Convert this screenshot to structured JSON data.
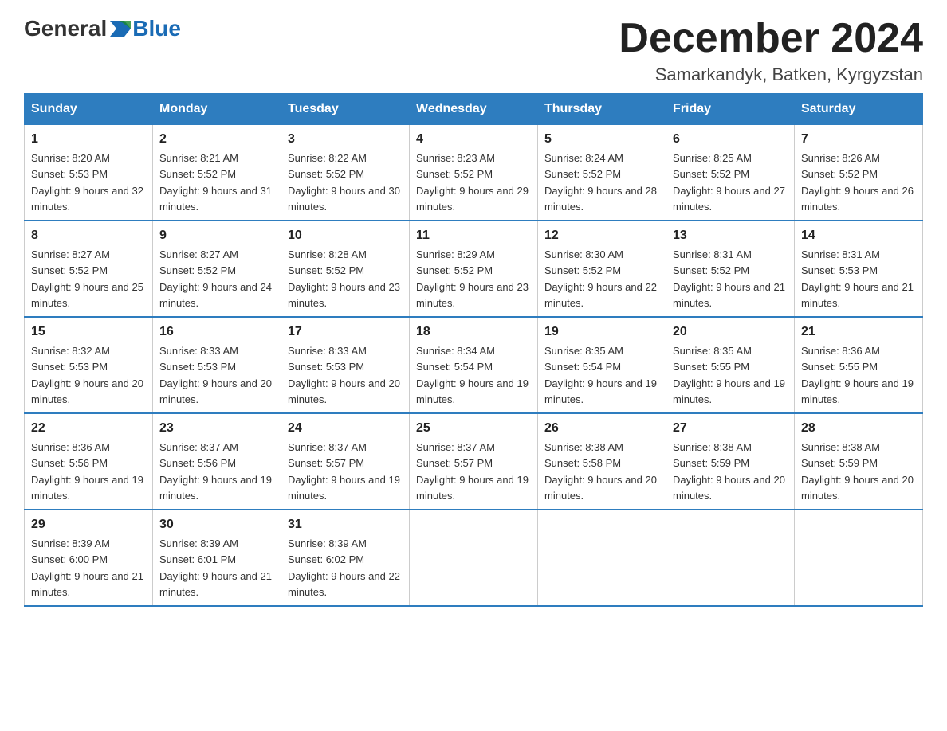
{
  "header": {
    "logo_general": "General",
    "logo_blue": "Blue",
    "month_title": "December 2024",
    "location": "Samarkandyk, Batken, Kyrgyzstan"
  },
  "weekdays": [
    "Sunday",
    "Monday",
    "Tuesday",
    "Wednesday",
    "Thursday",
    "Friday",
    "Saturday"
  ],
  "weeks": [
    [
      {
        "day": "1",
        "sunrise": "8:20 AM",
        "sunset": "5:53 PM",
        "daylight": "9 hours and 32 minutes."
      },
      {
        "day": "2",
        "sunrise": "8:21 AM",
        "sunset": "5:52 PM",
        "daylight": "9 hours and 31 minutes."
      },
      {
        "day": "3",
        "sunrise": "8:22 AM",
        "sunset": "5:52 PM",
        "daylight": "9 hours and 30 minutes."
      },
      {
        "day": "4",
        "sunrise": "8:23 AM",
        "sunset": "5:52 PM",
        "daylight": "9 hours and 29 minutes."
      },
      {
        "day": "5",
        "sunrise": "8:24 AM",
        "sunset": "5:52 PM",
        "daylight": "9 hours and 28 minutes."
      },
      {
        "day": "6",
        "sunrise": "8:25 AM",
        "sunset": "5:52 PM",
        "daylight": "9 hours and 27 minutes."
      },
      {
        "day": "7",
        "sunrise": "8:26 AM",
        "sunset": "5:52 PM",
        "daylight": "9 hours and 26 minutes."
      }
    ],
    [
      {
        "day": "8",
        "sunrise": "8:27 AM",
        "sunset": "5:52 PM",
        "daylight": "9 hours and 25 minutes."
      },
      {
        "day": "9",
        "sunrise": "8:27 AM",
        "sunset": "5:52 PM",
        "daylight": "9 hours and 24 minutes."
      },
      {
        "day": "10",
        "sunrise": "8:28 AM",
        "sunset": "5:52 PM",
        "daylight": "9 hours and 23 minutes."
      },
      {
        "day": "11",
        "sunrise": "8:29 AM",
        "sunset": "5:52 PM",
        "daylight": "9 hours and 23 minutes."
      },
      {
        "day": "12",
        "sunrise": "8:30 AM",
        "sunset": "5:52 PM",
        "daylight": "9 hours and 22 minutes."
      },
      {
        "day": "13",
        "sunrise": "8:31 AM",
        "sunset": "5:52 PM",
        "daylight": "9 hours and 21 minutes."
      },
      {
        "day": "14",
        "sunrise": "8:31 AM",
        "sunset": "5:53 PM",
        "daylight": "9 hours and 21 minutes."
      }
    ],
    [
      {
        "day": "15",
        "sunrise": "8:32 AM",
        "sunset": "5:53 PM",
        "daylight": "9 hours and 20 minutes."
      },
      {
        "day": "16",
        "sunrise": "8:33 AM",
        "sunset": "5:53 PM",
        "daylight": "9 hours and 20 minutes."
      },
      {
        "day": "17",
        "sunrise": "8:33 AM",
        "sunset": "5:53 PM",
        "daylight": "9 hours and 20 minutes."
      },
      {
        "day": "18",
        "sunrise": "8:34 AM",
        "sunset": "5:54 PM",
        "daylight": "9 hours and 19 minutes."
      },
      {
        "day": "19",
        "sunrise": "8:35 AM",
        "sunset": "5:54 PM",
        "daylight": "9 hours and 19 minutes."
      },
      {
        "day": "20",
        "sunrise": "8:35 AM",
        "sunset": "5:55 PM",
        "daylight": "9 hours and 19 minutes."
      },
      {
        "day": "21",
        "sunrise": "8:36 AM",
        "sunset": "5:55 PM",
        "daylight": "9 hours and 19 minutes."
      }
    ],
    [
      {
        "day": "22",
        "sunrise": "8:36 AM",
        "sunset": "5:56 PM",
        "daylight": "9 hours and 19 minutes."
      },
      {
        "day": "23",
        "sunrise": "8:37 AM",
        "sunset": "5:56 PM",
        "daylight": "9 hours and 19 minutes."
      },
      {
        "day": "24",
        "sunrise": "8:37 AM",
        "sunset": "5:57 PM",
        "daylight": "9 hours and 19 minutes."
      },
      {
        "day": "25",
        "sunrise": "8:37 AM",
        "sunset": "5:57 PM",
        "daylight": "9 hours and 19 minutes."
      },
      {
        "day": "26",
        "sunrise": "8:38 AM",
        "sunset": "5:58 PM",
        "daylight": "9 hours and 20 minutes."
      },
      {
        "day": "27",
        "sunrise": "8:38 AM",
        "sunset": "5:59 PM",
        "daylight": "9 hours and 20 minutes."
      },
      {
        "day": "28",
        "sunrise": "8:38 AM",
        "sunset": "5:59 PM",
        "daylight": "9 hours and 20 minutes."
      }
    ],
    [
      {
        "day": "29",
        "sunrise": "8:39 AM",
        "sunset": "6:00 PM",
        "daylight": "9 hours and 21 minutes."
      },
      {
        "day": "30",
        "sunrise": "8:39 AM",
        "sunset": "6:01 PM",
        "daylight": "9 hours and 21 minutes."
      },
      {
        "day": "31",
        "sunrise": "8:39 AM",
        "sunset": "6:02 PM",
        "daylight": "9 hours and 22 minutes."
      },
      null,
      null,
      null,
      null
    ]
  ]
}
